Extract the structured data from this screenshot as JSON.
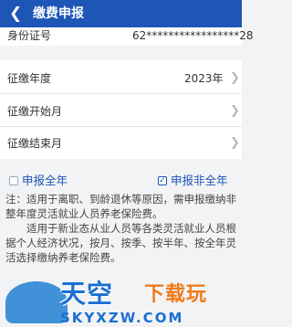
{
  "header": {
    "back_icon": "chevron-left-icon",
    "title": "缴费申报",
    "background": "#1d56b5"
  },
  "id_row": {
    "label": "身份证号",
    "value": "62*****************28"
  },
  "form": {
    "year_label": "征缴年度",
    "year_value": "2023年",
    "start_month_label": "征缴开始月",
    "end_month_label": "征缴结束月",
    "chevron_icon": "chevron-right-icon"
  },
  "options": {
    "full_year_label": "申报全年",
    "full_year_checked": false,
    "non_full_year_label": "申报非全年",
    "non_full_year_checked": true,
    "accent": "#1d56b5"
  },
  "notes": {
    "paragraph1": "注：适用于离职、到龄退休等原因，需申报缴纳非整年度灵活就业人员养老保险费。",
    "paragraph2": "　　适用于新业态从业人员等各类灵活就业人员根据个人经济状况，按月、按季、按半年、按全年灵活选择缴纳养老保险费。"
  },
  "watermark": {
    "cn_main": "天空",
    "cn_sub": "下载玩",
    "en": "SKYXZW.COM"
  }
}
